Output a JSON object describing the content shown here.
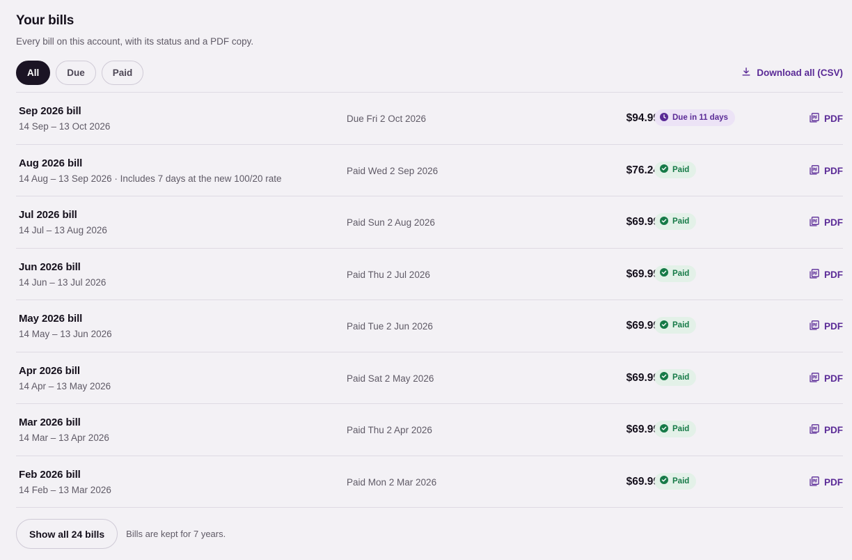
{
  "header": {
    "title": "Your bills",
    "subtitle": "Every bill on this account, with its status and a PDF copy."
  },
  "filters": [
    {
      "label": "All",
      "active": true
    },
    {
      "label": "Due",
      "active": false
    },
    {
      "label": "Paid",
      "active": false
    }
  ],
  "download_all_label": "Download all (CSV)",
  "pdf_label": "PDF",
  "bills": [
    {
      "name": "Sep 2026 bill",
      "period": "14 Sep – 13 Oct 2026",
      "date": "Due Fri 2 Oct 2026",
      "amount": "$94.99",
      "status": "Due in 11 days",
      "status_type": "due"
    },
    {
      "name": "Aug 2026 bill",
      "period": "14 Aug – 13 Sep 2026 · Includes 7 days at the new 100/20 rate",
      "date": "Paid Wed 2 Sep 2026",
      "amount": "$76.24",
      "status": "Paid",
      "status_type": "paid"
    },
    {
      "name": "Jul 2026 bill",
      "period": "14 Jul – 13 Aug 2026",
      "date": "Paid Sun 2 Aug 2026",
      "amount": "$69.99",
      "status": "Paid",
      "status_type": "paid"
    },
    {
      "name": "Jun 2026 bill",
      "period": "14 Jun – 13 Jul 2026",
      "date": "Paid Thu 2 Jul 2026",
      "amount": "$69.99",
      "status": "Paid",
      "status_type": "paid"
    },
    {
      "name": "May 2026 bill",
      "period": "14 May – 13 Jun 2026",
      "date": "Paid Tue 2 Jun 2026",
      "amount": "$69.99",
      "status": "Paid",
      "status_type": "paid"
    },
    {
      "name": "Apr 2026 bill",
      "period": "14 Apr – 13 May 2026",
      "date": "Paid Sat 2 May 2026",
      "amount": "$69.99",
      "status": "Paid",
      "status_type": "paid"
    },
    {
      "name": "Mar 2026 bill",
      "period": "14 Mar – 13 Apr 2026",
      "date": "Paid Thu 2 Apr 2026",
      "amount": "$69.99",
      "status": "Paid",
      "status_type": "paid"
    },
    {
      "name": "Feb 2026 bill",
      "period": "14 Feb – 13 Mar 2026",
      "date": "Paid Mon 2 Mar 2026",
      "amount": "$69.99",
      "status": "Paid",
      "status_type": "paid"
    }
  ],
  "footer": {
    "show_all_label": "Show all 24 bills",
    "retention_note": "Bills are kept for 7 years."
  },
  "colors": {
    "accent": "#5a2a96",
    "paid_green": "#167a47",
    "active_chip": "#1b1424",
    "background": "#f3f1f5"
  },
  "icons": {
    "download": "download-icon",
    "pdf": "pdf-file-icon",
    "paid": "check-circle-icon",
    "due": "clock-icon"
  }
}
